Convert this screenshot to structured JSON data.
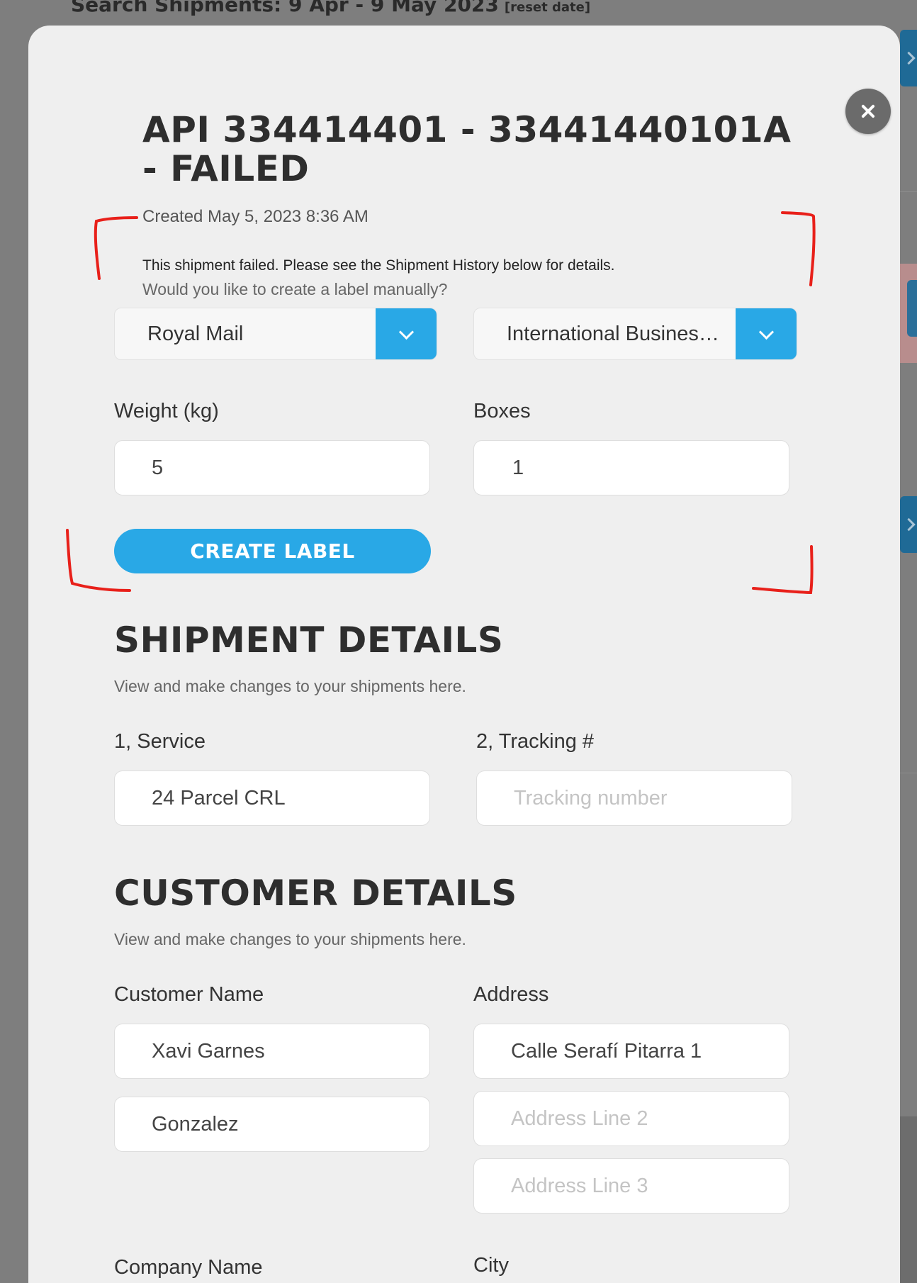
{
  "background": {
    "title": "Search Shipments: 9 Apr - 9 May 2023",
    "reset_link": "[reset date]"
  },
  "modal": {
    "title": "API 334414401 - 33441440101A - FAILED",
    "created": "Created May 5, 2023 8:36 AM",
    "failed_message": "This shipment failed. Please see the Shipment History below for details.",
    "manual_question": "Would you like to create a label manually?",
    "carrier_select": {
      "value": "Royal Mail"
    },
    "service_select": {
      "value": "International Business..."
    },
    "weight": {
      "label": "Weight (kg)",
      "value": "5"
    },
    "boxes": {
      "label": "Boxes",
      "value": "1"
    },
    "create_label_button": "CREATE LABEL"
  },
  "shipment_details": {
    "title": "SHIPMENT DETAILS",
    "subtitle": "View and make changes to your shipments here.",
    "service": {
      "label": "1, Service",
      "value": "24 Parcel  CRL"
    },
    "tracking": {
      "label": "2, Tracking #",
      "placeholder": "Tracking number"
    }
  },
  "customer_details": {
    "title": "CUSTOMER DETAILS",
    "subtitle": "View and make changes to your shipments here.",
    "customer_name": {
      "label": "Customer Name",
      "first": "Xavi Garnes",
      "last": "Gonzalez"
    },
    "address": {
      "label": "Address",
      "line1": "Calle Serafí Pitarra 1",
      "line2_placeholder": "Address Line 2",
      "line3_placeholder": "Address Line 3"
    },
    "company_name": {
      "label": "Company Name"
    },
    "city": {
      "label": "City"
    }
  },
  "colors": {
    "accent": "#29a8e6",
    "annotation": "#e8201a",
    "close_button": "#6b6b6b"
  },
  "icons": {
    "close": "close-icon",
    "dropdown": "chevron-down-icon",
    "side_tab": "chevron-right-icon"
  }
}
